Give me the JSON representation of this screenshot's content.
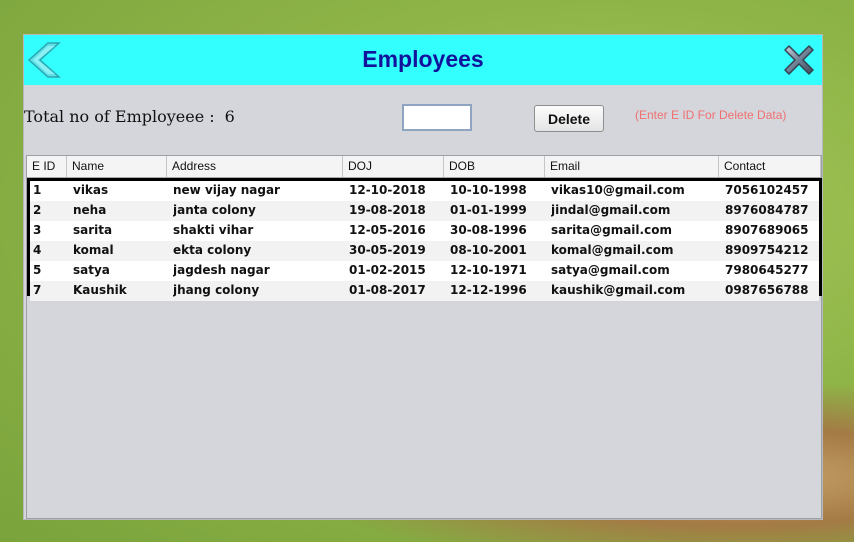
{
  "window": {
    "title": "Employees"
  },
  "summary": {
    "label": "Total no of Employeee :",
    "count": "6"
  },
  "delete_form": {
    "input_value": "",
    "button_label": "Delete",
    "hint": "(Enter E ID For Delete Data)"
  },
  "icons": {
    "back": "back-arrow-icon",
    "close": "close-x-icon"
  },
  "colors": {
    "titlebar": "#33ffff",
    "title": "#12129c",
    "hint": "#f07070"
  },
  "table": {
    "columns": [
      "E ID",
      "Name",
      "Address",
      "DOJ",
      "DOB",
      "Email",
      "Contact"
    ],
    "rows": [
      [
        "1",
        "vikas",
        "new vijay nagar",
        "12-10-2018",
        "10-10-1998",
        "vikas10@gmail.com",
        "7056102457"
      ],
      [
        "2",
        "neha",
        "janta colony",
        "19-08-2018",
        "01-01-1999",
        "jindal@gmail.com",
        "8976084787"
      ],
      [
        "3",
        "sarita",
        "shakti vihar",
        "12-05-2016",
        "30-08-1996",
        "sarita@gmail.com",
        "8907689065"
      ],
      [
        "4",
        "komal",
        "ekta colony",
        "30-05-2019",
        "08-10-2001",
        "komal@gmail.com",
        "8909754212"
      ],
      [
        "5",
        "satya",
        "jagdesh nagar",
        "01-02-2015",
        "12-10-1971",
        "satya@gmail.com",
        "7980645277"
      ],
      [
        "7",
        "Kaushik",
        "jhang colony",
        "01-08-2017",
        "12-12-1996",
        "kaushik@gmail.com",
        "0987656788"
      ]
    ]
  }
}
